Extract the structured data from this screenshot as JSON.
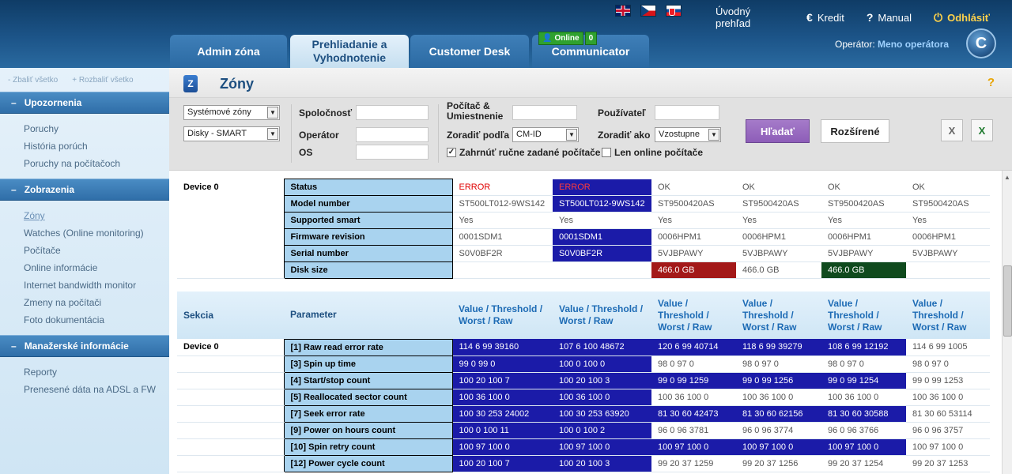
{
  "header": {
    "languages": [
      "English",
      "Čeština",
      "Slovenčina"
    ],
    "links": [
      {
        "label": "Úvodný prehľad",
        "icon": ""
      },
      {
        "label": "Kredit",
        "icon": "euro-icon"
      },
      {
        "label": "Manual",
        "icon": "question-icon"
      },
      {
        "label": "Odhlásiť",
        "icon": "power-icon"
      }
    ],
    "tabs": [
      "Admin zóna",
      "Prehliadanie a Vyhodnotenie",
      "Customer Desk",
      "Communicator"
    ],
    "online": {
      "label": "Online",
      "count": "0"
    },
    "operator_label": "Operátor:",
    "operator_name": "Meno operátora",
    "logo_letter": "C"
  },
  "sidebar": {
    "collapse_all": "- Zbaliť všetko",
    "expand_all": "+ Rozbaliť všetko",
    "sections": [
      {
        "title": "Upozornenia",
        "items": [
          "Poruchy",
          "História porúch",
          "Poruchy na počítačoch"
        ]
      },
      {
        "title": "Zobrazenia",
        "items": [
          "Zóny",
          "Watches (Online monitoring)",
          "Počítače",
          "Online informácie",
          "Internet bandwidth monitor",
          "Zmeny na počítači",
          "Foto dokumentácia"
        ]
      },
      {
        "title": "Manažerské informácie",
        "items": [
          "Reporty",
          "Prenesené dáta na ADSL a FW"
        ]
      }
    ]
  },
  "page": {
    "title": "Zóny",
    "help": "?"
  },
  "filters": {
    "zone_select": "Systémové zóny",
    "disk_select": "Disky - SMART",
    "company": "Spoločnosť",
    "operator": "Operátor",
    "os": "OS",
    "computer": "Počítač & Umiestnenie",
    "sort_by": "Zoradiť podľa",
    "sort_by_value": "CM-ID",
    "user": "Používateľ",
    "sort_as": "Zoradiť ako",
    "sort_as_value": "Vzostupne",
    "include_manual": "Zahrnúť ručne zadané počítače",
    "only_online": "Len online počítače",
    "search_button": "Hľadať",
    "advanced_button": "Rozšírené"
  },
  "device": {
    "name": "Device 0",
    "rows": [
      {
        "label": "Status",
        "values": [
          "ERROR",
          "ERROR",
          "OK",
          "OK",
          "OK",
          "OK"
        ]
      },
      {
        "label": "Model number",
        "values": [
          "ST500LT012-9WS142",
          "ST500LT012-9WS142",
          "ST9500420AS",
          "ST9500420AS",
          "ST9500420AS",
          "ST9500420AS"
        ]
      },
      {
        "label": "Supported smart",
        "values": [
          "Yes",
          "Yes",
          "Yes",
          "Yes",
          "Yes",
          "Yes"
        ]
      },
      {
        "label": "Firmware revision",
        "values": [
          "0001SDM1",
          "0001SDM1",
          "0006HPM1",
          "0006HPM1",
          "0006HPM1",
          "0006HPM1"
        ]
      },
      {
        "label": "Serial number",
        "values": [
          "S0V0BF2R",
          "S0V0BF2R",
          "5VJBPAWY",
          "5VJBPAWY",
          "5VJBPAWY",
          "5VJBPAWY"
        ]
      },
      {
        "label": "Disk size",
        "values": [
          "",
          "",
          "466.0 GB",
          "466.0 GB",
          "466.0 GB",
          ""
        ]
      }
    ]
  },
  "smart": {
    "headers": [
      "Sekcia",
      "Parameter",
      "Value / Threshold / Worst / Raw",
      "Value / Threshold / Worst / Raw",
      "Value / Threshold / Worst / Raw",
      "Value / Threshold / Worst / Raw",
      "Value / Threshold / Worst / Raw",
      "Value / Threshold / Worst / Raw"
    ],
    "device": "Device 0",
    "rows": [
      {
        "label": "[1] Raw read error rate",
        "values": [
          "114 6 99 39160",
          "107 6 100 48672",
          "120 6 99 40714",
          "118 6 99 39279",
          "108 6 99 12192",
          "114 6 99 1005"
        ]
      },
      {
        "label": "[3] Spin up time",
        "values": [
          "99 0 99 0",
          "100 0 100 0",
          "98 0 97 0",
          "98 0 97 0",
          "98 0 97 0",
          "98 0 97 0"
        ]
      },
      {
        "label": "[4] Start/stop count",
        "values": [
          "100 20 100 7",
          "100 20 100 3",
          "99 0 99 1259",
          "99 0 99 1256",
          "99 0 99 1254",
          "99 0 99 1253"
        ]
      },
      {
        "label": "[5] Reallocated sector count",
        "values": [
          "100 36 100 0",
          "100 36 100 0",
          "100 36 100 0",
          "100 36 100 0",
          "100 36 100 0",
          "100 36 100 0"
        ]
      },
      {
        "label": "[7] Seek error rate",
        "values": [
          "100 30 253 24002",
          "100 30 253 63920",
          "81 30 60 42473",
          "81 30 60 62156",
          "81 30 60 30588",
          "81 30 60 53114"
        ]
      },
      {
        "label": "[9] Power on hours count",
        "values": [
          "100 0 100 11",
          "100 0 100 2",
          "96 0 96 3781",
          "96 0 96 3774",
          "96 0 96 3766",
          "96 0 96 3757"
        ]
      },
      {
        "label": "[10] Spin retry count",
        "values": [
          "100 97 100 0",
          "100 97 100 0",
          "100 97 100 0",
          "100 97 100 0",
          "100 97 100 0",
          "100 97 100 0"
        ]
      },
      {
        "label": "[12] Power cycle count",
        "values": [
          "100 20 100 7",
          "100 20 100 3",
          "99 20 37 1259",
          "99 20 37 1256",
          "99 20 37 1254",
          "99 20 37 1253"
        ]
      }
    ]
  }
}
